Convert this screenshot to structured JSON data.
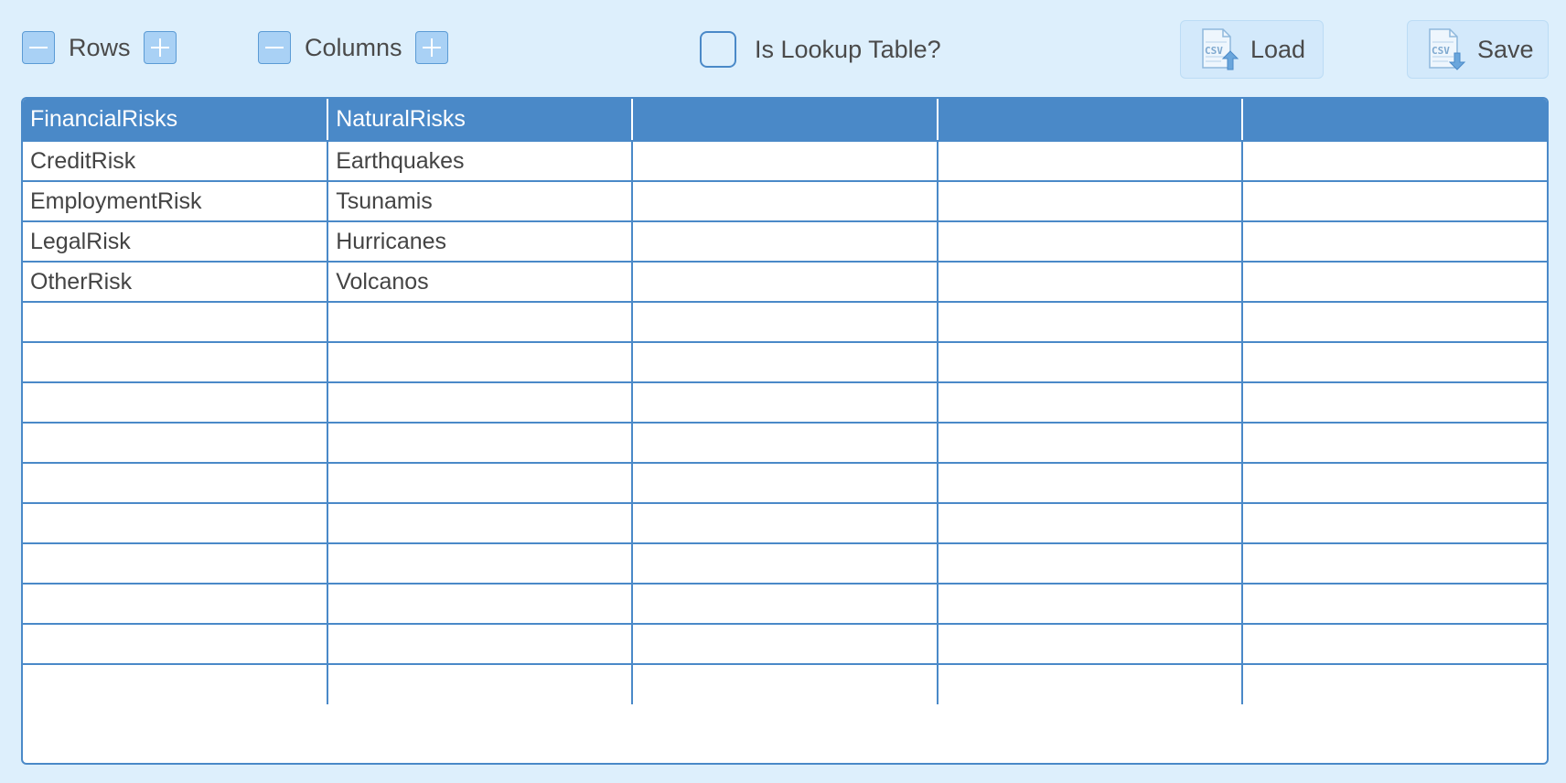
{
  "toolbar": {
    "rows_label": "Rows",
    "columns_label": "Columns",
    "lookup_label": "Is Lookup Table?",
    "lookup_checked": false,
    "load_label": "Load",
    "save_label": "Save",
    "icons": {
      "decrement": "minus-icon",
      "increment": "plus-icon",
      "load": "csv-upload-icon",
      "save": "csv-download-icon"
    }
  },
  "table": {
    "headers": [
      "FinancialRisks",
      "NaturalRisks",
      "",
      "",
      ""
    ],
    "rows": [
      [
        "CreditRisk",
        "Earthquakes",
        "",
        "",
        ""
      ],
      [
        "EmploymentRisk",
        "Tsunamis",
        "",
        "",
        ""
      ],
      [
        "LegalRisk",
        "Hurricanes",
        "",
        "",
        ""
      ],
      [
        "OtherRisk",
        "Volcanos",
        "",
        "",
        ""
      ],
      [
        "",
        "",
        "",
        "",
        ""
      ],
      [
        "",
        "",
        "",
        "",
        ""
      ],
      [
        "",
        "",
        "",
        "",
        ""
      ],
      [
        "",
        "",
        "",
        "",
        ""
      ],
      [
        "",
        "",
        "",
        "",
        ""
      ],
      [
        "",
        "",
        "",
        "",
        ""
      ],
      [
        "",
        "",
        "",
        "",
        ""
      ],
      [
        "",
        "",
        "",
        "",
        ""
      ],
      [
        "",
        "",
        "",
        "",
        ""
      ],
      [
        "",
        "",
        "",
        "",
        ""
      ]
    ]
  },
  "colors": {
    "background": "#ddeffc",
    "accent": "#4a89c8",
    "button_fill": "#a9d1f5"
  }
}
